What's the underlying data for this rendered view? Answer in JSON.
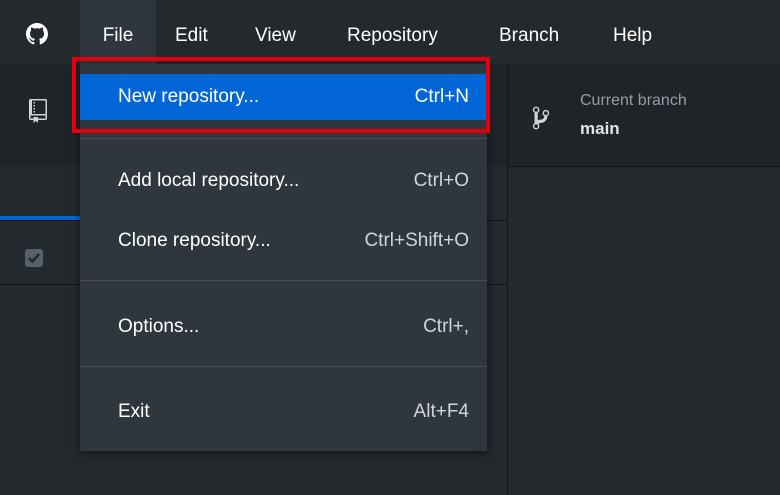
{
  "menubar": {
    "items": [
      {
        "label": "File"
      },
      {
        "label": "Edit"
      },
      {
        "label": "View"
      },
      {
        "label": "Repository"
      },
      {
        "label": "Branch"
      },
      {
        "label": "Help"
      }
    ]
  },
  "toolbar": {
    "branch_label": "Current branch",
    "branch_value": "main"
  },
  "file_menu": {
    "items": [
      {
        "label": "New repository...",
        "shortcut": "Ctrl+N"
      },
      {
        "label": "Add local repository...",
        "shortcut": "Ctrl+O"
      },
      {
        "label": "Clone repository...",
        "shortcut": "Ctrl+Shift+O"
      },
      {
        "label": "Options...",
        "shortcut": "Ctrl+,"
      },
      {
        "label": "Exit",
        "shortcut": "Alt+F4"
      }
    ],
    "highlighted_item": "New repository..."
  },
  "colors": {
    "background": "#24292e",
    "menu_background": "#2f363d",
    "highlight": "#0366d6",
    "annotation_box": "#e3000b"
  },
  "icons": [
    "github-logo-icon",
    "repository-icon",
    "branch-icon",
    "checkbox-icon"
  ]
}
